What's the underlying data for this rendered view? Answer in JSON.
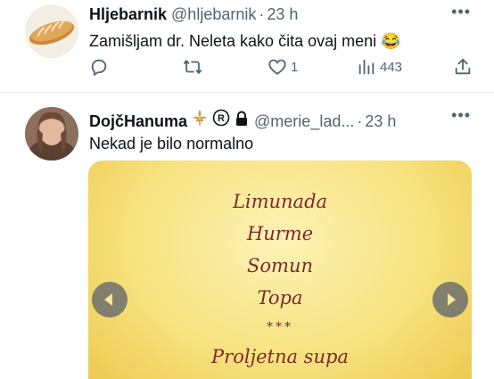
{
  "tweets": [
    {
      "name": "Hljebarnik",
      "handle": "@hljebarnik",
      "separator": "·",
      "time": "23 h",
      "text": "Zamišljam dr. Neleta kako čita ovaj meni",
      "emoji": "😂",
      "actions": {
        "replies": "",
        "retweets": "",
        "likes": "1",
        "views": "443"
      },
      "avatar_icon": "bread-icon"
    },
    {
      "name": "DojčHanuma",
      "handle": "@merie_lad...",
      "separator": "·",
      "time": "23 h",
      "text": "Nekad je bilo normalno",
      "name_badges": [
        "fleur-de-lis-icon",
        "registered-icon",
        "lock-icon"
      ],
      "media": {
        "menu_items": [
          "Limunada",
          "Hurme",
          "Somun",
          "Topa",
          "***",
          "Proljetna supa"
        ]
      }
    }
  ],
  "colors": {
    "text_primary": "#0f1419",
    "text_secondary": "#536471",
    "menu_text": "#7c2a2a",
    "divider": "#e7e9ea"
  }
}
